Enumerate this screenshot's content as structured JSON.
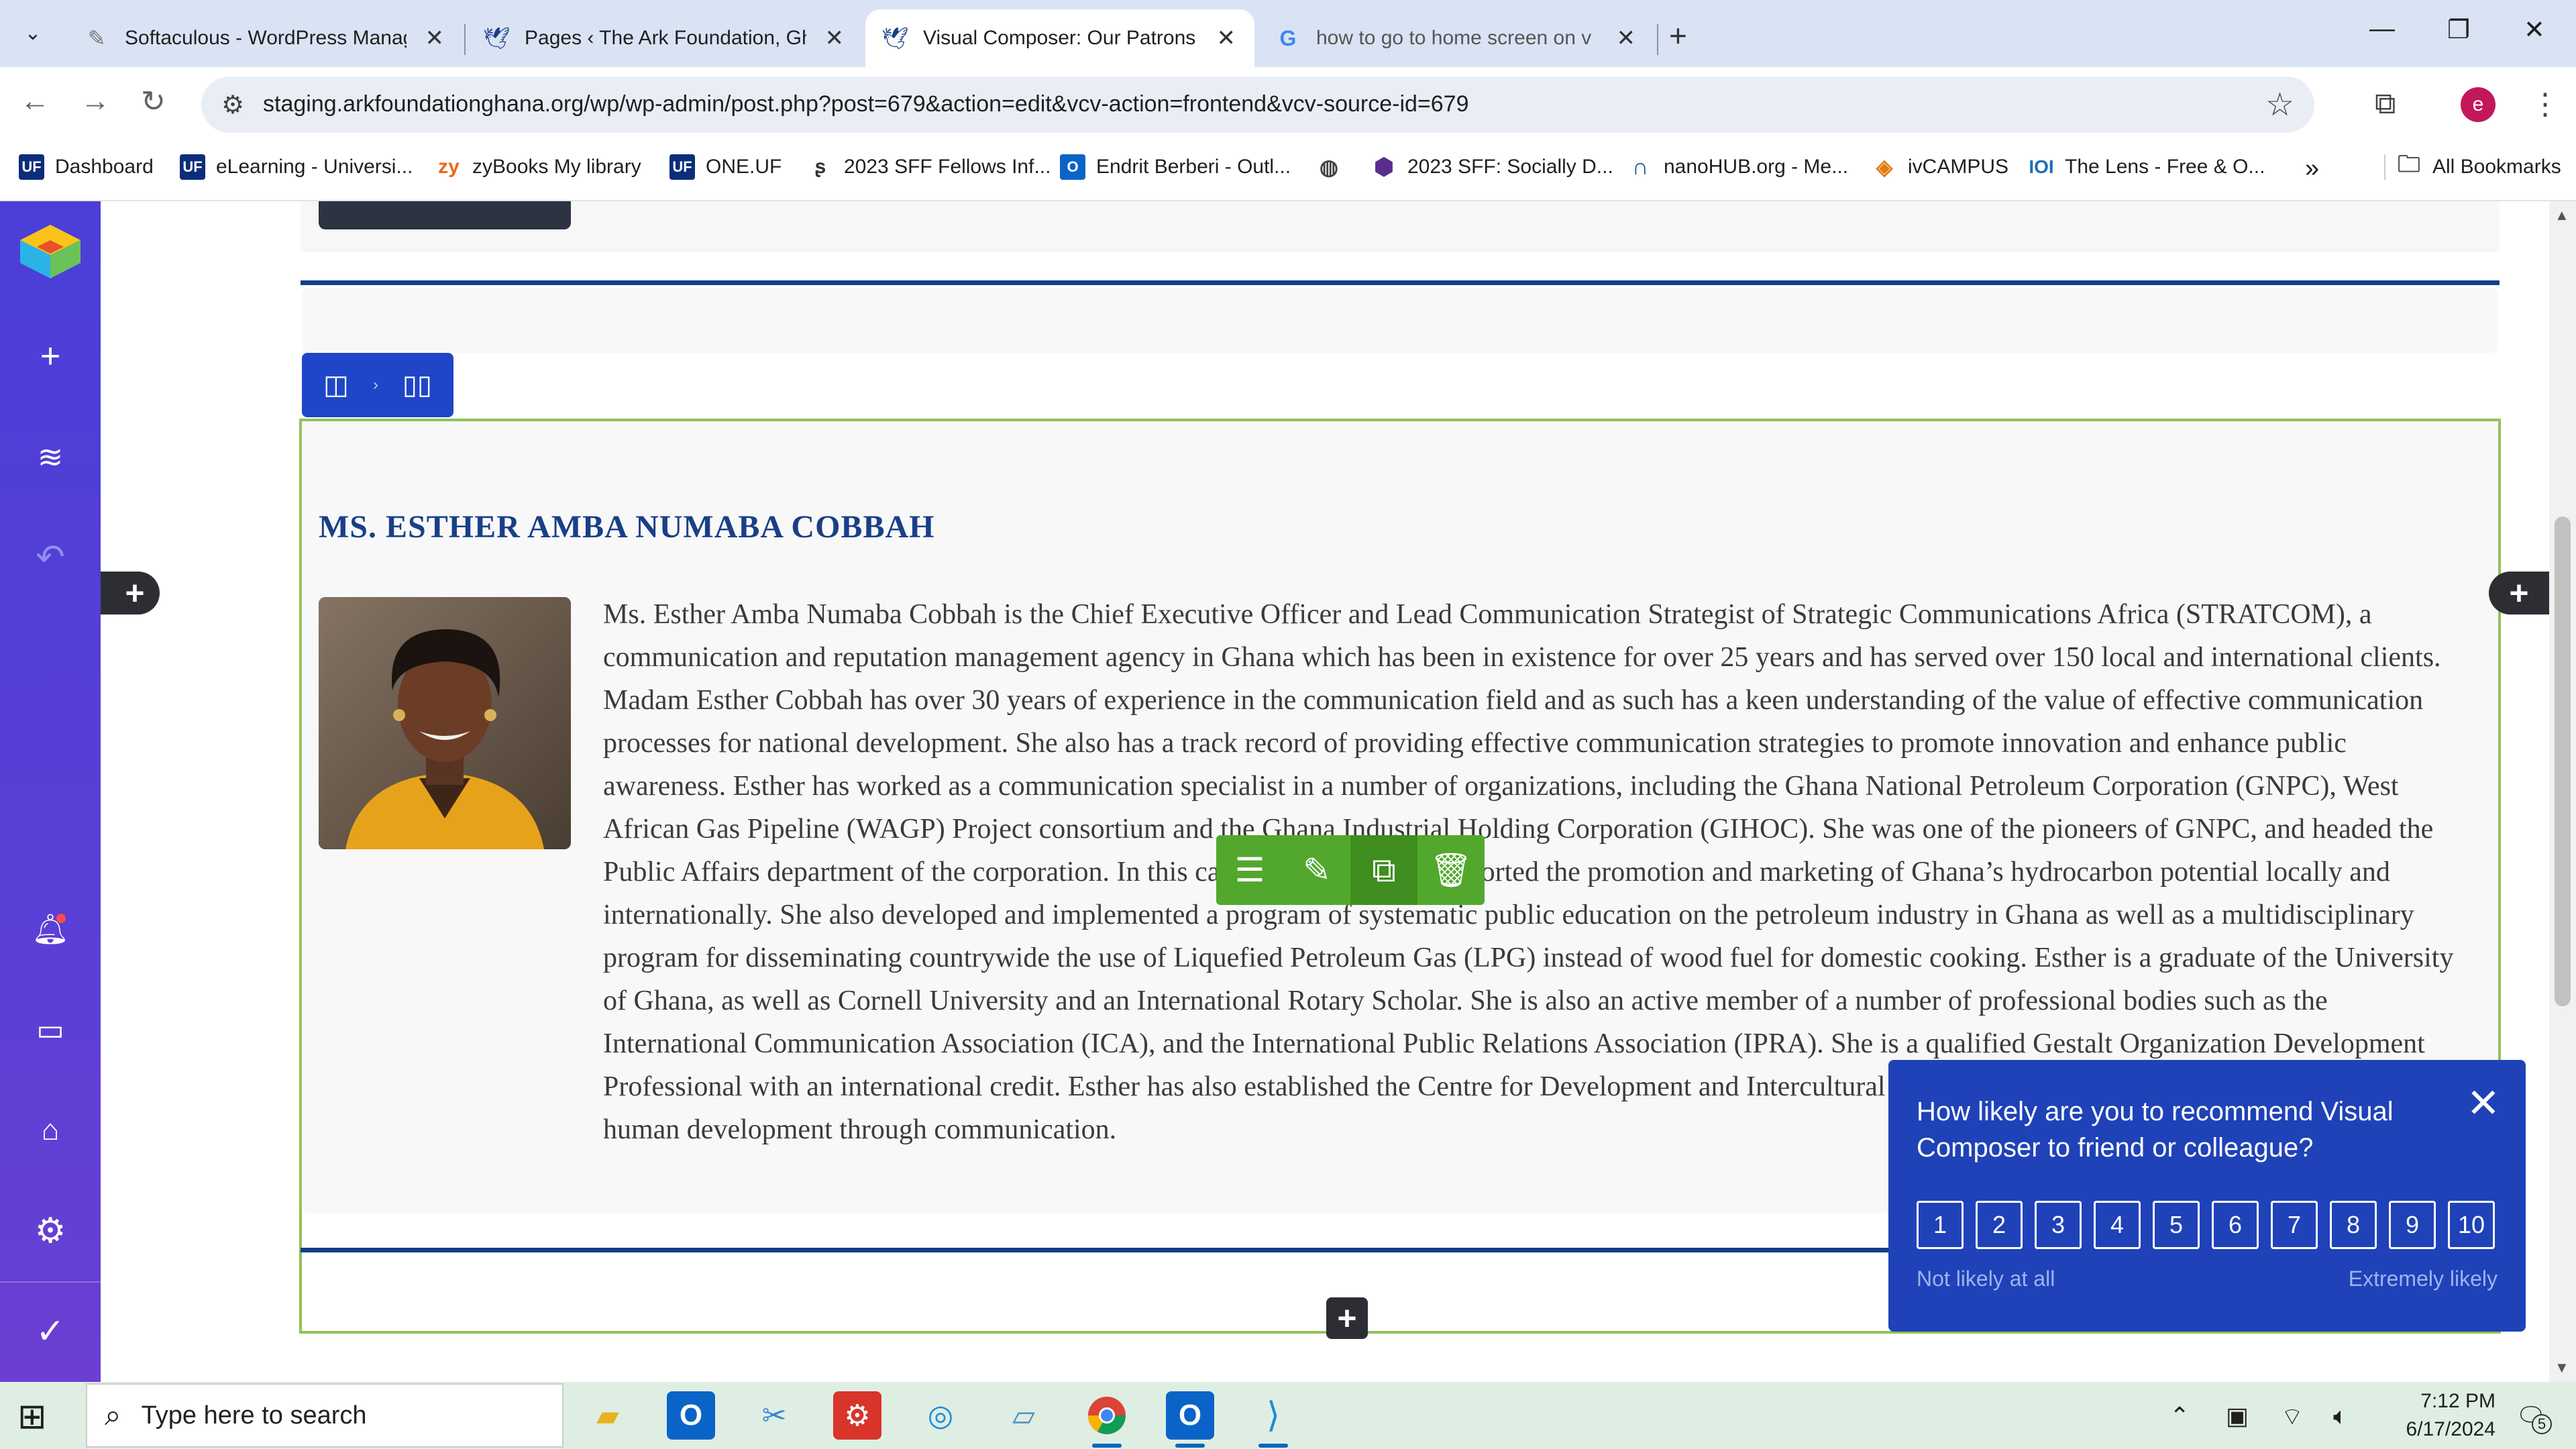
{
  "browser": {
    "tabs": [
      {
        "title": "Softaculous - WordPress Manag",
        "favicon": "softaculous-icon",
        "active": false
      },
      {
        "title": "Pages ‹ The Ark Foundation, Gh",
        "favicon": "ark-foundation-icon",
        "active": false
      },
      {
        "title": "Visual Composer: Our Patrons",
        "favicon": "ark-foundation-icon",
        "active": true
      },
      {
        "title": "how to go to home screen on v",
        "favicon": "google-icon",
        "active": false
      }
    ],
    "url": "staging.arkfoundationghana.org/wp/wp-admin/post.php?post=679&action=edit&vcv-action=frontend&vcv-source-id=679",
    "profile_initial": "e",
    "bookmarks": [
      {
        "label": "Dashboard",
        "icon": "uf-icon"
      },
      {
        "label": "eLearning - Universi...",
        "icon": "uf-icon"
      },
      {
        "label": "zyBooks My library",
        "icon": "zybooks-icon"
      },
      {
        "label": "ONE.UF",
        "icon": "uf-icon"
      },
      {
        "label": "2023 SFF Fellows Inf...",
        "icon": "doc-icon"
      },
      {
        "label": "Endrit Berberi - Outl...",
        "icon": "outlook-icon"
      },
      {
        "label": "",
        "icon": "globe-icon"
      },
      {
        "label": "2023 SFF: Socially D...",
        "icon": "cube-icon"
      },
      {
        "label": "nanoHUB.org - Me...",
        "icon": "nanohub-icon"
      },
      {
        "label": "ivCAMPUS",
        "icon": "ivcampus-icon"
      },
      {
        "label": "The Lens - Free & O...",
        "icon": "lens-icon"
      }
    ],
    "all_bookmarks_label": "All Bookmarks"
  },
  "page": {
    "patron_name": "MS. ESTHER AMBA NUMABA COBBAH",
    "bio": "Ms. Esther Amba Numaba Cobbah is the Chief Executive Officer and Lead Communication Strategist of Strategic Communications Africa (STRATCOM), a communication and reputation management agency in Ghana which has been in existence for over 25 years and has served over 150 local and international clients. Madam Esther Cobbah has over 30 years of experience in the communication field and as such has a keen understanding of the value of effective communication processes for national development. She also has a track record of providing effective communication strategies to promote innovation and enhance public awareness. Esther has worked as a communication specialist in a number of organizations, including the Ghana National Petroleum Corporation (GNPC), West African Gas Pipeline (WAGP) Project consortium and the Ghana Industrial Holding Corporation (GIHOC). She was one of the pioneers of GNPC, and headed the Public Affairs department of the corporation. In this capacity, she keenly supported the promotion and marketing of Ghana’s hydrocarbon potential locally and internationally. She also developed and implemented a program of systematic public education on the petroleum industry in Ghana as well as a multidisciplinary program for disseminating countrywide the use of Liquefied Petroleum Gas (LPG) instead of wood fuel for domestic cooking. Esther is a graduate of the University of Ghana, as well as Cornell University and an International Rotary Scholar. She is also an active member of a number of professional bodies such as the International Communication Association (ICA), and the International Public Relations Association (IPRA). She is a qualified Gestalt Organization Development Professional with an international credit. Esther has also established the Centre for Development and Intercultural Communication (CEDIC), an NGO dedicated to human development through communication."
  },
  "survey": {
    "question": "How likely are you to recommend Visual Composer to friend or colleague?",
    "scale": [
      "1",
      "2",
      "3",
      "4",
      "5",
      "6",
      "7",
      "8",
      "9",
      "10"
    ],
    "low_label": "Not likely at all",
    "high_label": "Extremely likely"
  },
  "taskbar": {
    "search_placeholder": "Type here to search",
    "time": "7:12 PM",
    "date": "6/17/2024",
    "notification_count": "5"
  },
  "colors": {
    "vc_rail": "#4a3fd8",
    "accent_blue": "#1f42b8",
    "element_green": "#52a82c",
    "heading_navy": "#1a3f86"
  }
}
